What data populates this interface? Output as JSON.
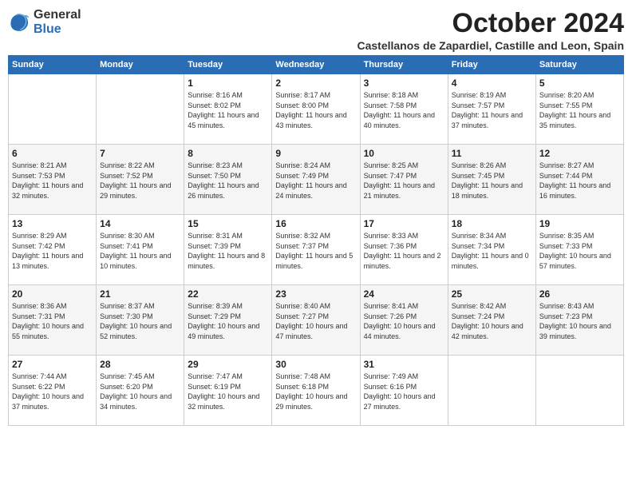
{
  "header": {
    "logo_general": "General",
    "logo_blue": "Blue",
    "month_title": "October 2024",
    "location": "Castellanos de Zapardiel, Castille and Leon, Spain"
  },
  "days_of_week": [
    "Sunday",
    "Monday",
    "Tuesday",
    "Wednesday",
    "Thursday",
    "Friday",
    "Saturday"
  ],
  "weeks": [
    [
      {
        "day": "",
        "info": ""
      },
      {
        "day": "",
        "info": ""
      },
      {
        "day": "1",
        "info": "Sunrise: 8:16 AM\nSunset: 8:02 PM\nDaylight: 11 hours and 45 minutes."
      },
      {
        "day": "2",
        "info": "Sunrise: 8:17 AM\nSunset: 8:00 PM\nDaylight: 11 hours and 43 minutes."
      },
      {
        "day": "3",
        "info": "Sunrise: 8:18 AM\nSunset: 7:58 PM\nDaylight: 11 hours and 40 minutes."
      },
      {
        "day": "4",
        "info": "Sunrise: 8:19 AM\nSunset: 7:57 PM\nDaylight: 11 hours and 37 minutes."
      },
      {
        "day": "5",
        "info": "Sunrise: 8:20 AM\nSunset: 7:55 PM\nDaylight: 11 hours and 35 minutes."
      }
    ],
    [
      {
        "day": "6",
        "info": "Sunrise: 8:21 AM\nSunset: 7:53 PM\nDaylight: 11 hours and 32 minutes."
      },
      {
        "day": "7",
        "info": "Sunrise: 8:22 AM\nSunset: 7:52 PM\nDaylight: 11 hours and 29 minutes."
      },
      {
        "day": "8",
        "info": "Sunrise: 8:23 AM\nSunset: 7:50 PM\nDaylight: 11 hours and 26 minutes."
      },
      {
        "day": "9",
        "info": "Sunrise: 8:24 AM\nSunset: 7:49 PM\nDaylight: 11 hours and 24 minutes."
      },
      {
        "day": "10",
        "info": "Sunrise: 8:25 AM\nSunset: 7:47 PM\nDaylight: 11 hours and 21 minutes."
      },
      {
        "day": "11",
        "info": "Sunrise: 8:26 AM\nSunset: 7:45 PM\nDaylight: 11 hours and 18 minutes."
      },
      {
        "day": "12",
        "info": "Sunrise: 8:27 AM\nSunset: 7:44 PM\nDaylight: 11 hours and 16 minutes."
      }
    ],
    [
      {
        "day": "13",
        "info": "Sunrise: 8:29 AM\nSunset: 7:42 PM\nDaylight: 11 hours and 13 minutes."
      },
      {
        "day": "14",
        "info": "Sunrise: 8:30 AM\nSunset: 7:41 PM\nDaylight: 11 hours and 10 minutes."
      },
      {
        "day": "15",
        "info": "Sunrise: 8:31 AM\nSunset: 7:39 PM\nDaylight: 11 hours and 8 minutes."
      },
      {
        "day": "16",
        "info": "Sunrise: 8:32 AM\nSunset: 7:37 PM\nDaylight: 11 hours and 5 minutes."
      },
      {
        "day": "17",
        "info": "Sunrise: 8:33 AM\nSunset: 7:36 PM\nDaylight: 11 hours and 2 minutes."
      },
      {
        "day": "18",
        "info": "Sunrise: 8:34 AM\nSunset: 7:34 PM\nDaylight: 11 hours and 0 minutes."
      },
      {
        "day": "19",
        "info": "Sunrise: 8:35 AM\nSunset: 7:33 PM\nDaylight: 10 hours and 57 minutes."
      }
    ],
    [
      {
        "day": "20",
        "info": "Sunrise: 8:36 AM\nSunset: 7:31 PM\nDaylight: 10 hours and 55 minutes."
      },
      {
        "day": "21",
        "info": "Sunrise: 8:37 AM\nSunset: 7:30 PM\nDaylight: 10 hours and 52 minutes."
      },
      {
        "day": "22",
        "info": "Sunrise: 8:39 AM\nSunset: 7:29 PM\nDaylight: 10 hours and 49 minutes."
      },
      {
        "day": "23",
        "info": "Sunrise: 8:40 AM\nSunset: 7:27 PM\nDaylight: 10 hours and 47 minutes."
      },
      {
        "day": "24",
        "info": "Sunrise: 8:41 AM\nSunset: 7:26 PM\nDaylight: 10 hours and 44 minutes."
      },
      {
        "day": "25",
        "info": "Sunrise: 8:42 AM\nSunset: 7:24 PM\nDaylight: 10 hours and 42 minutes."
      },
      {
        "day": "26",
        "info": "Sunrise: 8:43 AM\nSunset: 7:23 PM\nDaylight: 10 hours and 39 minutes."
      }
    ],
    [
      {
        "day": "27",
        "info": "Sunrise: 7:44 AM\nSunset: 6:22 PM\nDaylight: 10 hours and 37 minutes."
      },
      {
        "day": "28",
        "info": "Sunrise: 7:45 AM\nSunset: 6:20 PM\nDaylight: 10 hours and 34 minutes."
      },
      {
        "day": "29",
        "info": "Sunrise: 7:47 AM\nSunset: 6:19 PM\nDaylight: 10 hours and 32 minutes."
      },
      {
        "day": "30",
        "info": "Sunrise: 7:48 AM\nSunset: 6:18 PM\nDaylight: 10 hours and 29 minutes."
      },
      {
        "day": "31",
        "info": "Sunrise: 7:49 AM\nSunset: 6:16 PM\nDaylight: 10 hours and 27 minutes."
      },
      {
        "day": "",
        "info": ""
      },
      {
        "day": "",
        "info": ""
      }
    ]
  ]
}
